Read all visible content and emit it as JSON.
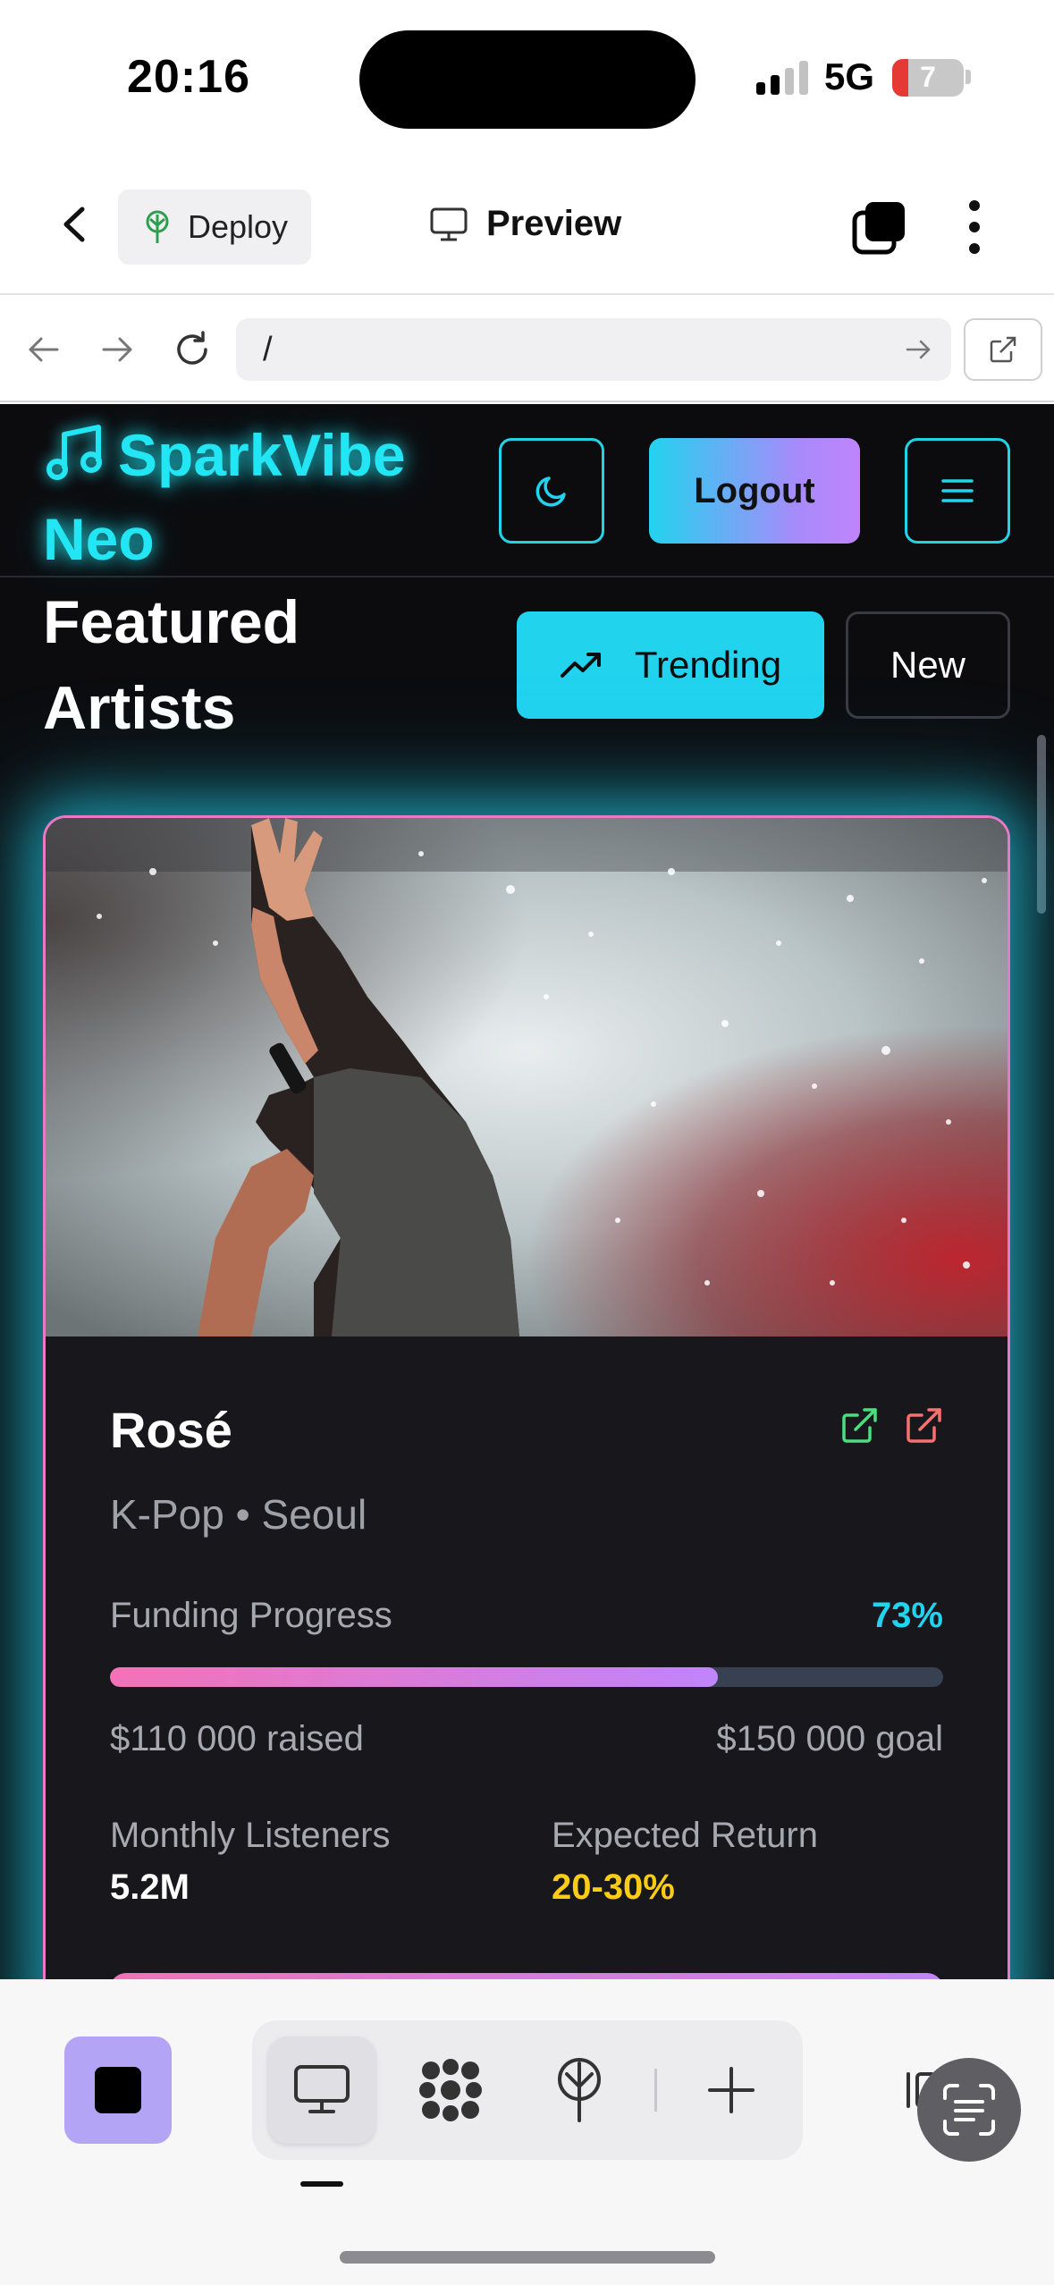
{
  "status_bar": {
    "time": "20:16",
    "network": "5G",
    "battery": "7"
  },
  "toolbar": {
    "deploy_label": "Deploy",
    "preview_label": "Preview"
  },
  "browser": {
    "url": "/"
  },
  "site": {
    "logo_text": "SparkVibe Neo",
    "logout_label": "Logout",
    "section_title": "Featured Artists",
    "filters": {
      "trending_label": "Trending",
      "new_label": "New"
    }
  },
  "artist_card": {
    "name": "Rosé",
    "genre_location": "K-Pop • Seoul",
    "funding_label": "Funding Progress",
    "funding_percent_text": "73%",
    "funding_progress": 0.73,
    "raised_text": "$110 000 raised",
    "goal_text": "$150 000 goal",
    "listeners_label": "Monthly Listeners",
    "listeners_value": "5.2M",
    "return_label": "Expected Return",
    "return_value": "20-30%"
  },
  "colors": {
    "accent_cyan": "#22d3ee",
    "accent_pink": "#f472b6",
    "accent_purple": "#c084fc",
    "return_yellow": "#facc15",
    "link_green": "#4ade80",
    "link_red": "#f87171"
  },
  "icons": {
    "toolbar": [
      "back-chevron-icon",
      "deploy-tree-icon",
      "monitor-icon",
      "tabs-icon",
      "more-vertical-icon"
    ],
    "browser": [
      "arrow-left-icon",
      "arrow-right-icon",
      "reload-icon",
      "arrow-go-icon",
      "external-link-icon"
    ],
    "site": [
      "music-note-icon",
      "moon-icon",
      "hamburger-menu-icon",
      "trending-up-icon"
    ],
    "bottom": [
      "stop-icon",
      "monitor-icon",
      "nodes-icon",
      "deploy-tree-icon",
      "plus-icon",
      "scan-text-icon"
    ]
  }
}
